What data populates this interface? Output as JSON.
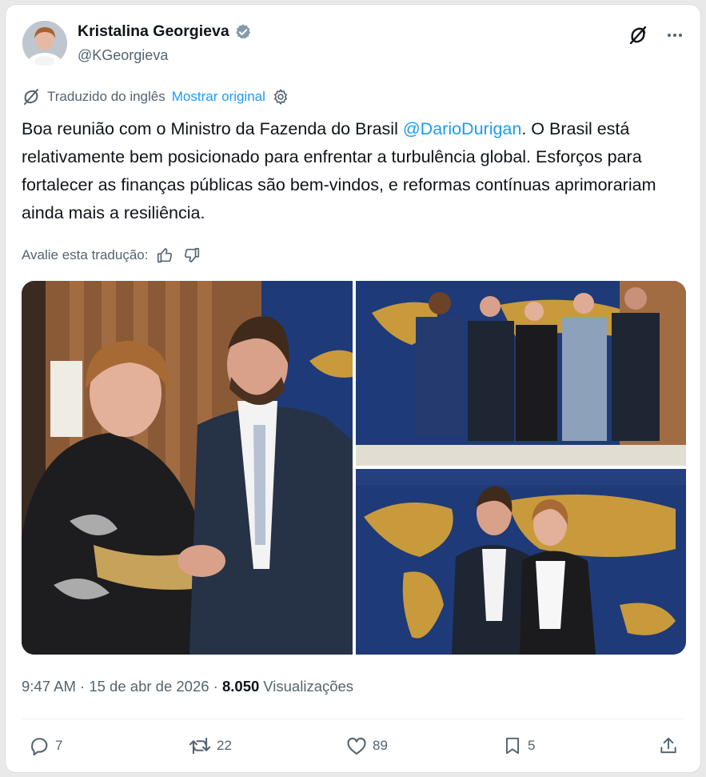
{
  "author": {
    "name": "Kristalina Georgieva",
    "handle": "@KGeorgieva",
    "verified": true
  },
  "translation": {
    "label": "Traduzido do inglês",
    "show_original": "Mostrar original"
  },
  "tweet": {
    "text_before": "Boa reunião com o Ministro da Fazenda do Brasil ",
    "mention": "@DarioDurigan",
    "text_after": ". O Brasil está relativamente bem posicionado para enfrentar a turbulência global. Esforços para fortalecer as finanças públicas são bem-vindos, e reformas contínuas aprimorariam ainda mais a resiliência."
  },
  "rate_translation": {
    "label": "Avalie esta tradução:"
  },
  "meta": {
    "time": "9:47 AM",
    "sep1": " · ",
    "date": "15 de abr de 2026",
    "sep2": " · ",
    "views_count": "8.050",
    "views_label": "Visualizações"
  },
  "actions": {
    "replies": "7",
    "reposts": "22",
    "likes": "89",
    "bookmarks": "5"
  },
  "icons": [
    "grok-icon",
    "more-icon",
    "translate-icon",
    "gear-icon",
    "thumbs-up-icon",
    "thumbs-down-icon",
    "reply-icon",
    "repost-icon",
    "like-icon",
    "bookmark-icon",
    "share-icon",
    "verified-badge-icon"
  ],
  "colors": {
    "accent": "#1d9bf0",
    "text": "#0f1419",
    "muted": "#536471"
  }
}
